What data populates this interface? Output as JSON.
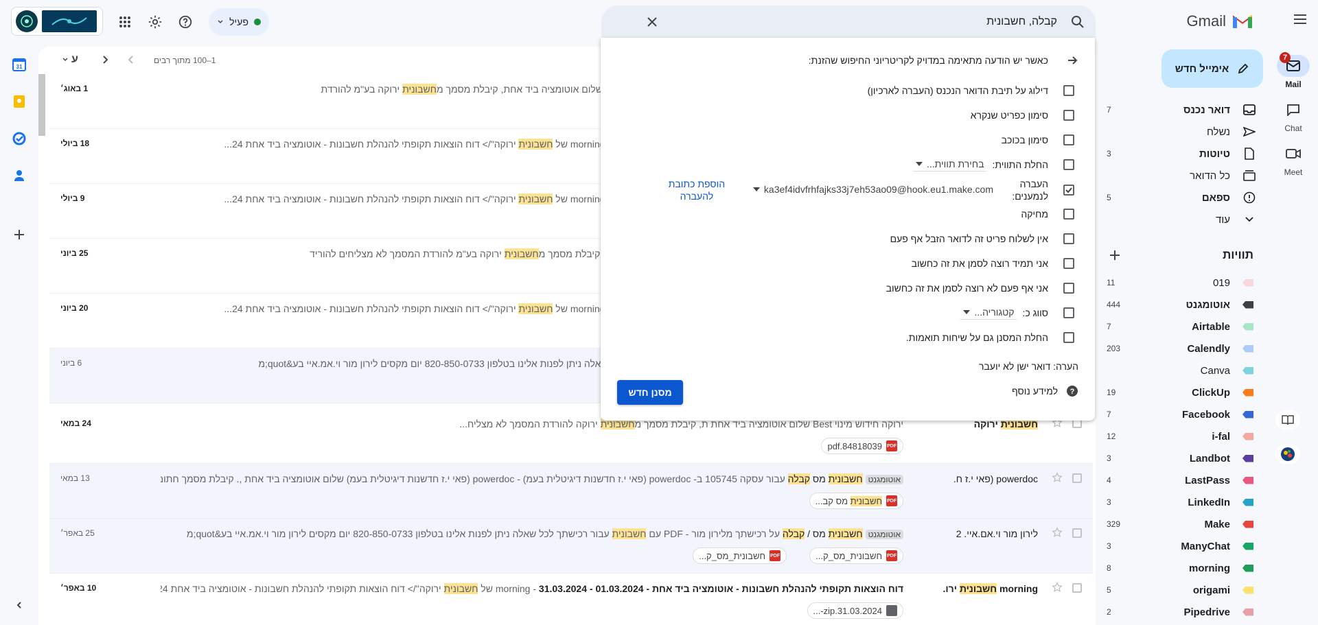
{
  "app": {
    "name": "Gmail"
  },
  "header": {
    "search_value": "קבלה, חשבונית",
    "status_label": "פעיל"
  },
  "rail": {
    "mail": {
      "label": "Mail",
      "badge": "7"
    },
    "chat": {
      "label": "Chat"
    },
    "meet": {
      "label": "Meet"
    }
  },
  "nav": {
    "compose": "אימייל חדש",
    "items": [
      {
        "label": "דואר נכנס",
        "count": "7"
      },
      {
        "label": "נשלח",
        "count": ""
      },
      {
        "label": "טיוטות",
        "count": "3"
      },
      {
        "label": "כל הדואר",
        "count": ""
      },
      {
        "label": "ספאם",
        "count": "5"
      },
      {
        "label": "עוד",
        "count": ""
      }
    ],
    "labels_title": "תוויות",
    "labels": [
      {
        "label": "019",
        "count": "11",
        "color": "#f8d7da",
        "bold": false
      },
      {
        "label": "אוטומגנט",
        "count": "444",
        "color": "#3c4043",
        "bold": true
      },
      {
        "label": "Airtable",
        "count": "7",
        "color": "#a8e6c5",
        "bold": true
      },
      {
        "label": "Calendly",
        "count": "203",
        "color": "#aecbfa",
        "bold": true
      },
      {
        "label": "Canva",
        "count": "",
        "color": "#7fd3df",
        "bold": false
      },
      {
        "label": "ClickUp",
        "count": "19",
        "color": "#fa7b17",
        "bold": true
      },
      {
        "label": "Facebook",
        "count": "7",
        "color": "#3367d6",
        "bold": true
      },
      {
        "label": "i-fal",
        "count": "12",
        "color": "#f4a7a0",
        "bold": true
      },
      {
        "label": "Landbot",
        "count": "3",
        "color": "#5b3e9e",
        "bold": true
      },
      {
        "label": "LastPass",
        "count": "4",
        "color": "#e8577e",
        "bold": true
      },
      {
        "label": "LinkedIn",
        "count": "3",
        "color": "#24a3c7",
        "bold": true
      },
      {
        "label": "Make",
        "count": "329",
        "color": "#e8453c",
        "bold": true
      },
      {
        "label": "ManyChat",
        "count": "3",
        "color": "#16a765",
        "bold": true
      },
      {
        "label": "morning",
        "count": "8",
        "color": "#1e9e5a",
        "bold": true
      },
      {
        "label": "origami",
        "count": "5",
        "color": "#fce26b",
        "bold": true
      },
      {
        "label": "Pipedrive",
        "count": "2",
        "color": "#e8a0a8",
        "bold": true
      }
    ]
  },
  "toolbar": {
    "pagination": "1–100 מתוך רבים",
    "lang": "ע"
  },
  "filter": {
    "header": "כאשר יש הודעה מתאימה במדויק לקריטריוני החיפוש שהזנת:",
    "skip_inbox": "דילוג על תיבת הדואר הנכנס (העברה לארכיון)",
    "mark_read": "סימון כפריט שנקרא",
    "star_it": "סימון בכוכב",
    "apply_label": "החלת התווית:",
    "choose_label": "בחירת תווית...",
    "forward_to": "העברה לנמענים:",
    "forward_email": "ka3ef4idvfrhfajks33j7eh53ao09@hook.eu1.make.com",
    "add_forward": "הוספת כתובת להעברה",
    "delete_it": "מחיקה",
    "never_spam": "אין לשלוח פריט זה לדואר הזבל אף פעם",
    "always_important": "אני תמיד רוצה לסמן את זה כחשוב",
    "never_important": "אני אף פעם לא רוצה לסמן את זה כחשוב",
    "categorize": "סווג כ:",
    "category": "קטגוריה...",
    "also_apply": "החלת המסנן גם על שיחות תואמות.",
    "note": "הערה: דואר ישן לא יועבר",
    "learn_more": "למידע נוסף",
    "create_button": "מסנן חדש"
  },
  "emails": [
    {
      "sender": "",
      "sub": "",
      "snippet_pre": "חודש אוגוסט 2024 שלום אוטומציה ביד אחת, קיבלת מסמך מ",
      "hl": "חשבונית",
      "snippet_post": " ירוקה בע\"מ להורדת",
      "date": "1 באוג׳",
      "unread": true
    },
    {
      "sender": "",
      "sub": "",
      "snippet_pre": "01 - 30.06.2024 - morning של ",
      "hl": "חשבונית",
      "snippet_post": " ירוקה\"/> דוח הוצאות תקופתי להנהלת חשבונות - אוטומציה ביד אחת 24...",
      "date": "18 ביולי",
      "unread": true
    },
    {
      "sender": "",
      "sub": "",
      "snippet_pre": "01 - 30.06.2024 - morning של ",
      "hl": "חשבונית",
      "snippet_post": " ירוקה\"/> דוח הוצאות תקופתי להנהלת חשבונות - אוטומציה ביד אחת 24...",
      "date": "9 ביולי",
      "unread": true
    },
    {
      "sender": "",
      "sub": "",
      "snippet_pre": "אוטומציה ביד אחת, קיבלת מסמך מ",
      "hl": "חשבונית",
      "snippet_post": " ירוקה בע\"מ להורדת המסמך לא מצליחים להוריד",
      "date": "25 ביוני",
      "unread": true
    },
    {
      "sender": "",
      "sub": "",
      "snippet_pre": "01 - 31.05.2024 - morning של ",
      "hl": "חשבונית",
      "snippet_post": " ירוקה\"/> דוח הוצאות תקופתי להנהלת חשבונות - אוטומציה ביד אחת 24...",
      "date": "20 ביוני",
      "unread": true
    },
    {
      "sender": "",
      "sub": "",
      "snippet_pre": "עבור רכישתך לכל שאלה ניתן לפנות אלינו בטלפון 820-850-0733 יום מקסים לירון מור וי.אמ.איי בע&quot;מ",
      "hl": "",
      "snippet_post": "",
      "date": "6 ביוני",
      "unread": false
    }
  ],
  "email7": {
    "sender_hl": "חשבונית",
    "sender_post": " ירוקה",
    "snippet_pre": "ירוקה חידוש מינוי Best שלום אוטומציה ביד אחת ת, קיבלת מסמך מ",
    "hl": "חשבונית",
    "snippet_post": " ירוקה להורדת המסמך לא מצליח...",
    "date": "24 במאי",
    "chip": "pdf.84818039"
  },
  "email8": {
    "sender": "powerdoc (פאי י.ז ח.",
    "tag": "אוטומגנט",
    "hl1": "חשבונית",
    "mid": " מס ",
    "hl2": "קבלה",
    "rest": " עבור עסקה 105745 ב- powerdoc (פאי י.ז חדשנות דיגיטלית בעמ) - powerdoc (פאי י.ז חדשנות דיגיטלית בעמ) שלום אוטומציה ביד אחת ,. קיבלת מסמך חתום ...",
    "date": "13 במאי",
    "chip_hl": "חשבונית",
    "chip_post": " מס קב..."
  },
  "email9": {
    "sender": "לירון מור וי.אם.איי. 2",
    "tag": "אוטומגנט",
    "hl1": "חשבונית",
    "mid": " מס / ",
    "hl2": "קבלה",
    "rest1": " על רכישתך מלירון מור - PDF עם ",
    "hl3": "חשבונית",
    "rest2": " עבור רכישתך לכל שאלה ניתן לפנות אלינו בטלפון 820-850-0733 יום מקסים לירון מור וי.אמ.איי בע&quot;מ",
    "date": "25 באפר׳",
    "chip1": "חשבונית_מס_ק...",
    "chip2": "חשבונית_מס_ק..."
  },
  "email10": {
    "sender_pre": "morning ",
    "sender_hl": "חשבונית",
    "sender_post": " ירו.",
    "sub": "דוח הוצאות תקופתי להנהלת חשבונות - אוטומציה ביד אחת - 01.03.2024 - 31.03.2024",
    "snippet_pre": " - morning של ",
    "hl": "חשבונית",
    "snippet_post": " ירוקה\"/> דוח הוצאות תקופתי להנהלת חשבונות - אוטומציה ביד אחת 24...",
    "date": "10 באפר׳",
    "chip": "31.03.2024.zip-..."
  }
}
